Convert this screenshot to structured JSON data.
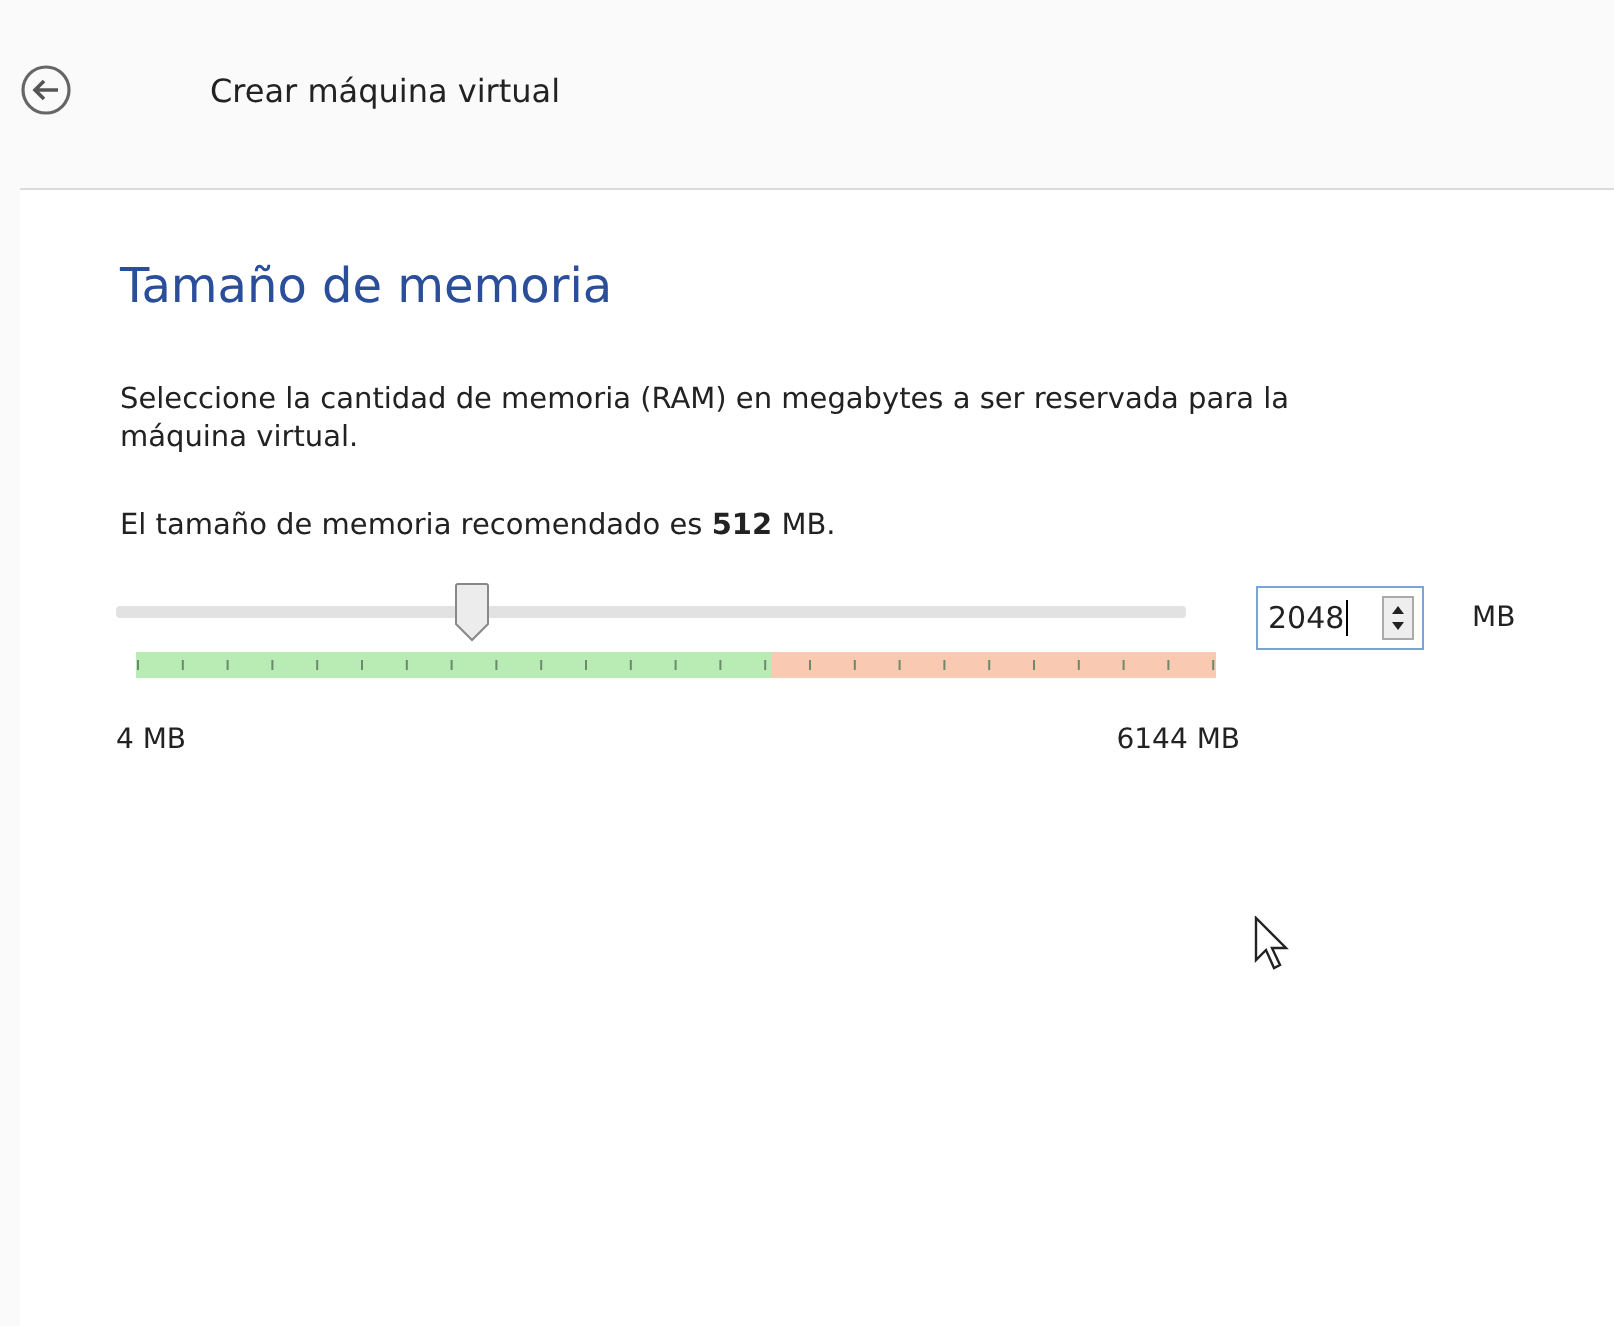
{
  "window": {
    "title": "Crear máquina virtual"
  },
  "heading": "Tamaño de memoria",
  "description": "Seleccione la cantidad de memoria (RAM) en megabytes a ser reservada para la máquina virtual.",
  "recommendation": "El tamaño de memoria recomendado es **512** MB.",
  "slider": {
    "level": 0.333,
    "min_label": "4 MB",
    "max_label": "6144 MB"
  },
  "spinbox": {
    "value": "2048",
    "unit": "MB"
  }
}
